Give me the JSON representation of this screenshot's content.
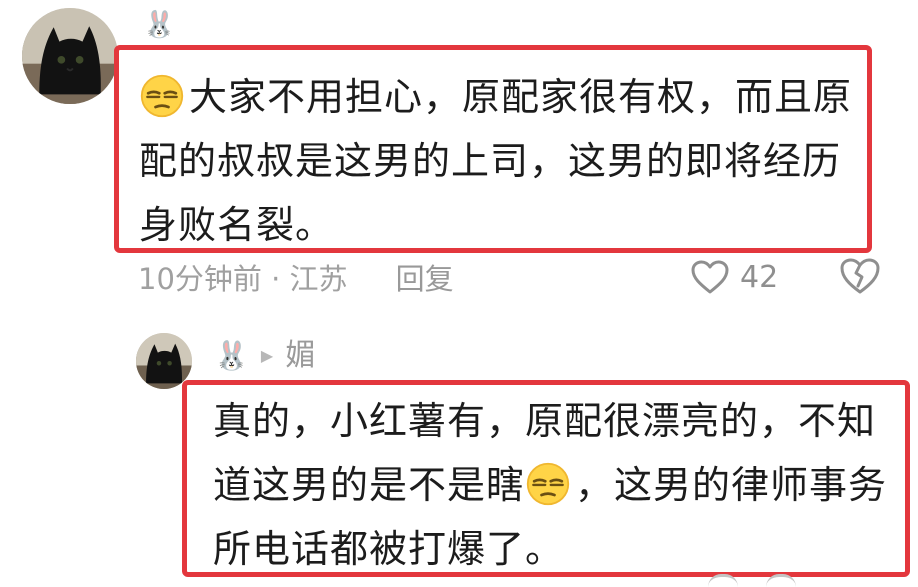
{
  "main_comment": {
    "username_icon": "rabbit-icon",
    "text_before_emoji": "",
    "emoji": "sleepy-face-emoji",
    "text": "大家不用担心，原配家很有权，而且原配的叔叔是这男的上司，这男的即将经历身败名裂。",
    "time": "10分钟前 · 江苏",
    "reply_label": "回复",
    "like_count": "42",
    "highlight_color": "#e3373d"
  },
  "reply_comment": {
    "username_icon": "rabbit-icon",
    "arrow_icon": "right-triangle-icon",
    "reply_to": "媚",
    "text_part1": "真的，小红薯有，原配很漂亮的，不知道这男的是不是瞎",
    "emoji": "sleepy-face-emoji",
    "text_part2": "，这男的律师事务所电话都被打爆了。",
    "highlight_color": "#e3373d"
  }
}
